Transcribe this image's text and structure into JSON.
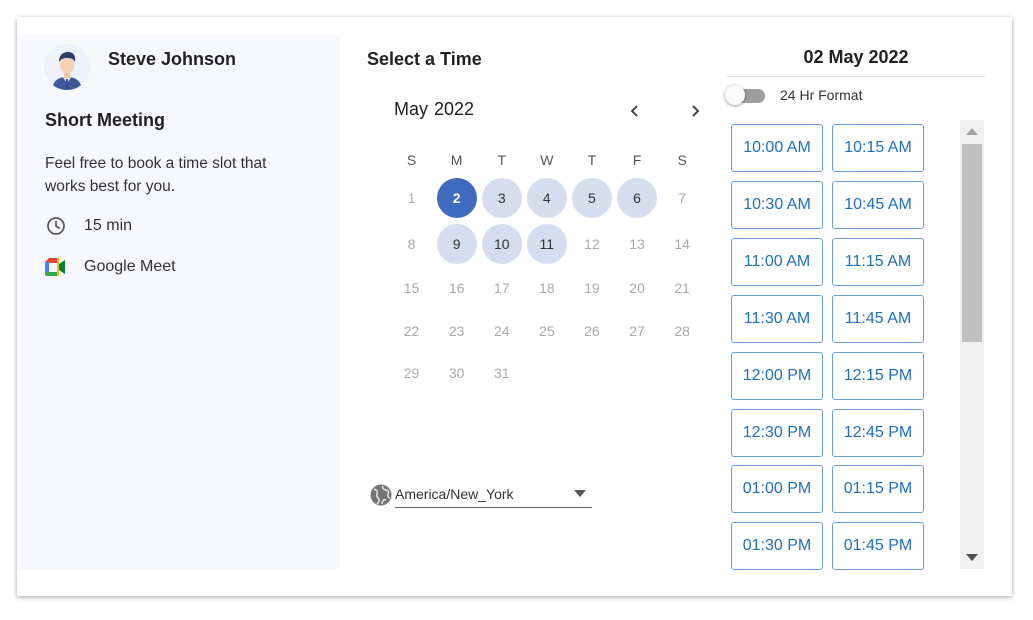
{
  "host": {
    "name": "Steve Johnson",
    "avatar_icon": "person-avatar-icon"
  },
  "meeting": {
    "title": "Short Meeting",
    "description": "Feel free to book a time slot that works best for you.",
    "duration": "15 min",
    "location": "Google Meet"
  },
  "picker": {
    "title": "Select a Time",
    "month": "May",
    "year": "2022",
    "weekdays": [
      "S",
      "M",
      "T",
      "W",
      "T",
      "F",
      "S"
    ],
    "weeks": [
      [
        "1",
        "2",
        "3",
        "4",
        "5",
        "6",
        "7"
      ],
      [
        "8",
        "9",
        "10",
        "11",
        "12",
        "13",
        "14"
      ],
      [
        "15",
        "16",
        "17",
        "18",
        "19",
        "20",
        "21"
      ],
      [
        "22",
        "23",
        "24",
        "25",
        "26",
        "27",
        "28"
      ],
      [
        "29",
        "30",
        "31"
      ]
    ],
    "available_days": [
      "3",
      "4",
      "5",
      "6",
      "9",
      "10",
      "11"
    ],
    "selected_day": "2",
    "timezone": "America/New_York"
  },
  "times": {
    "date": "02 May 2022",
    "format_toggle": "24 Hr Format",
    "format_24h": false,
    "slots": [
      "10:00 AM",
      "10:15 AM",
      "10:30 AM",
      "10:45 AM",
      "11:00 AM",
      "11:15 AM",
      "11:30 AM",
      "11:45 AM",
      "12:00 PM",
      "12:15 PM",
      "12:30 PM",
      "12:45 PM",
      "01:00 PM",
      "01:15 PM",
      "01:30 PM",
      "01:45 PM"
    ]
  },
  "colors": {
    "selected": "#3f6cbf",
    "available": "#d5deee",
    "slot_text": "#1e6fc0",
    "slot_border": "#6aa0d8"
  }
}
